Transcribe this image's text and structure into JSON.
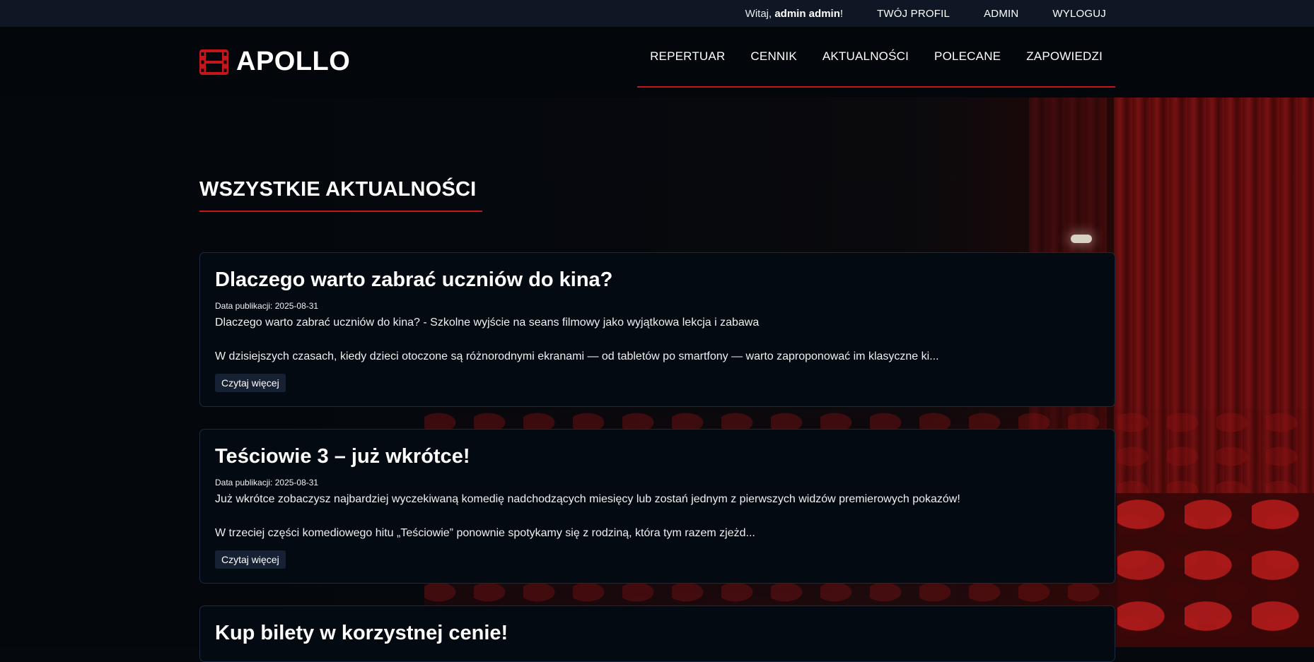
{
  "topbar": {
    "greeting_prefix": "Witaj, ",
    "username": "admin admin",
    "greeting_suffix": "!",
    "links": [
      "TWÓJ PROFIL",
      "ADMIN",
      "WYLOGUJ"
    ]
  },
  "brand": {
    "name": "APOLLO",
    "icon": "film-icon",
    "accent_color": "#c4161c"
  },
  "nav": {
    "items": [
      "REPERTUAR",
      "CENNIK",
      "AKTUALNOŚCI",
      "POLECANE",
      "ZAPOWIEDZI"
    ]
  },
  "page": {
    "title": "WSZYSTKIE AKTUALNOŚCI"
  },
  "news": [
    {
      "title": "Dlaczego warto zabrać uczniów do kina?",
      "date_label": "Data publikacji: ",
      "date": "2025-08-31",
      "lead": "Dlaczego warto zabrać uczniów do kina? - Szkolne wyjście na seans filmowy jako wyjątkowa lekcja i zabawa",
      "excerpt": "W dzisiejszych czasach, kiedy dzieci otoczone są różnorodnymi ekranami — od tabletów po smartfony — warto zaproponować im klasyczne ki...",
      "button": "Czytaj więcej"
    },
    {
      "title": "Teściowie 3 – już wkrótce!",
      "date_label": "Data publikacji: ",
      "date": "2025-08-31",
      "lead": "Już wkrótce zobaczysz najbardziej wyczekiwaną komedię nadchodzących miesięcy lub zostań jednym z pierwszych widzów premierowych pokazów!",
      "excerpt": "W trzeciej części komediowego hitu „Teściowie” ponownie spotykamy się z rodziną, która tym razem zjeżd...",
      "button": "Czytaj więcej"
    },
    {
      "title": "Kup bilety w korzystnej cenie!"
    }
  ]
}
